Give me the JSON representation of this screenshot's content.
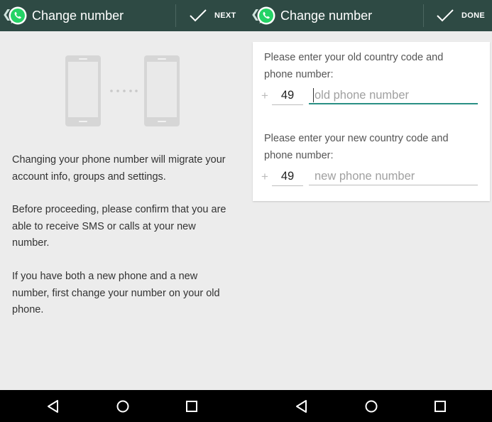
{
  "left_screen": {
    "appbar": {
      "title": "Change number",
      "action_label": "NEXT",
      "back_icon": "chevron-left-icon",
      "logo_icon": "whatsapp-logo-icon",
      "action_icon": "checkmark-icon"
    },
    "illustration_icon": "phones-transfer-icon",
    "paragraphs": [
      "Changing your phone number will migrate your account info, groups and settings.",
      "Before proceeding, please confirm that you are able to receive SMS or calls at your new number.",
      "If you have both a new phone and a new number, first change your number on your old phone."
    ]
  },
  "right_screen": {
    "appbar": {
      "title": "Change number",
      "action_label": "DONE",
      "back_icon": "chevron-left-icon",
      "logo_icon": "whatsapp-logo-icon",
      "action_icon": "checkmark-icon"
    },
    "old_number": {
      "prompt": "Please enter your old country code and phone number:",
      "plus": "+",
      "country_code": "49",
      "placeholder": "old phone number"
    },
    "new_number": {
      "prompt": "Please enter your new country code and phone number:",
      "plus": "+",
      "country_code": "49",
      "placeholder": "new phone number"
    }
  },
  "navbar": {
    "icons": [
      "back-triangle-icon",
      "home-circle-icon",
      "recents-square-icon"
    ]
  },
  "colors": {
    "appbar": "#2e4a44",
    "whatsapp_green": "#25d366",
    "focus_accent": "#2a8f84",
    "background": "#ececec"
  }
}
